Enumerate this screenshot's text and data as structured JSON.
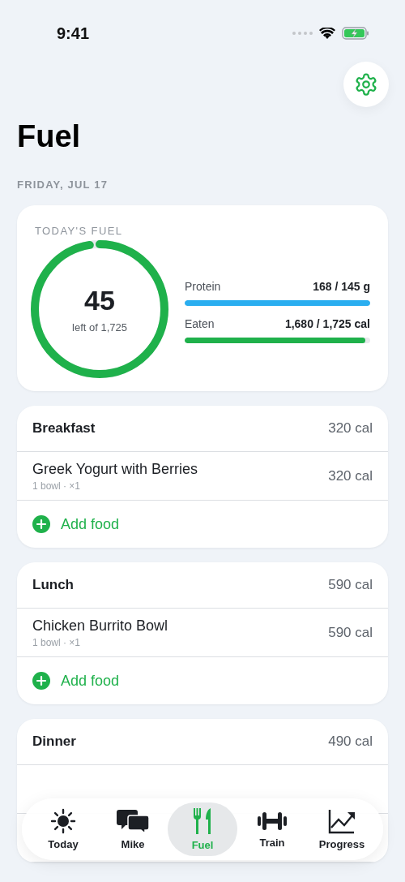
{
  "status_bar": {
    "time": "9:41"
  },
  "title": "Fuel",
  "date": "FRIDAY, JUL 17",
  "summary": {
    "heading": "TODAY'S FUEL",
    "ring": {
      "value": "45",
      "caption": "left of 1,725",
      "level": 0.974
    },
    "bars": [
      {
        "label": "Protein",
        "reading": "168 / 145 g",
        "level": 1,
        "color": "#2aaef0"
      },
      {
        "label": "Eaten",
        "reading": "1,680 / 1,725 cal",
        "level": 0.974,
        "color": "#1fb14b"
      }
    ]
  },
  "meals": [
    {
      "name": "Breakfast",
      "total": "320 cal",
      "items": [
        {
          "name": "Greek Yogurt with Berries",
          "detail": "1 bowl · ×1",
          "calories": "320 cal"
        }
      ],
      "add_label": "Add food"
    },
    {
      "name": "Lunch",
      "total": "590 cal",
      "items": [
        {
          "name": "Chicken Burrito Bowl",
          "detail": "1 bowl · ×1",
          "calories": "590 cal"
        }
      ],
      "add_label": "Add food"
    },
    {
      "name": "Dinner",
      "total": "490 cal"
    }
  ],
  "tabs": [
    {
      "label": "Today",
      "kind": "sun",
      "selected": false
    },
    {
      "label": "Mike",
      "kind": "chat",
      "selected": false
    },
    {
      "label": "Fuel",
      "kind": "fork",
      "selected": true
    },
    {
      "label": "Train",
      "kind": "dumbbell",
      "selected": false
    },
    {
      "label": "Progress",
      "kind": "chart",
      "selected": false
    }
  ]
}
